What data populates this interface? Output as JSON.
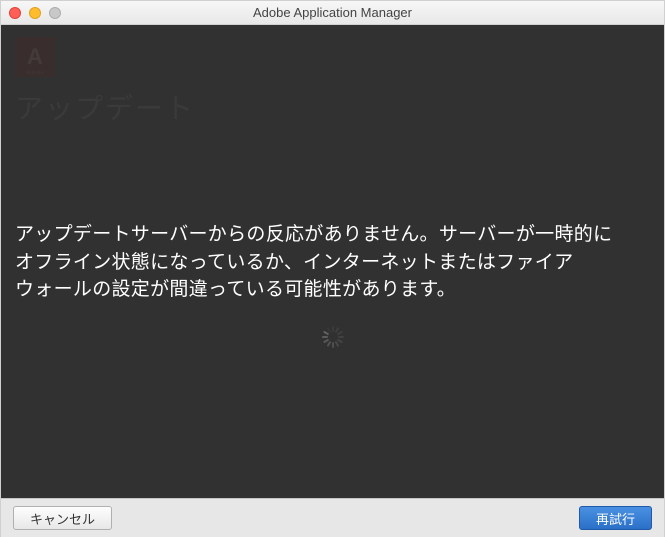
{
  "window": {
    "title": "Adobe Application Manager"
  },
  "background": {
    "logo_text": "A",
    "logo_sub": "Adobe",
    "heading": "アップデート"
  },
  "dialog": {
    "error_line1": "アップデートサーバーからの反応がありません。サーバーが一時的に",
    "error_line2": "オフライン状態になっているか、インターネットまたはファイア",
    "error_line3": "ウォールの設定が間違っている可能性があります。"
  },
  "footer": {
    "cancel_label": "キャンセル",
    "retry_label": "再試行"
  }
}
